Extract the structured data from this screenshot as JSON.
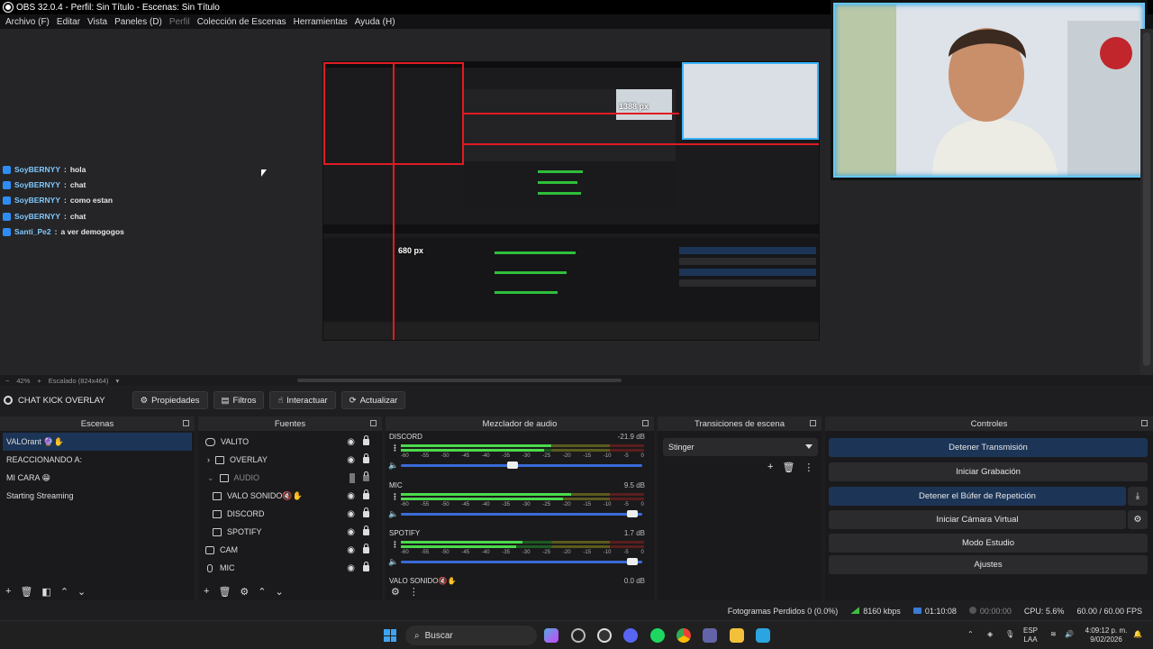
{
  "window": {
    "title": "OBS 32.0.4 - Perfil: Sin Título - Escenas: Sin Título"
  },
  "menu": [
    {
      "label": "Archivo (F)",
      "disabled": false
    },
    {
      "label": "Editar",
      "disabled": false
    },
    {
      "label": "Vista",
      "disabled": false
    },
    {
      "label": "Paneles (D)",
      "disabled": false
    },
    {
      "label": "Perfil",
      "disabled": true
    },
    {
      "label": "Colección de Escenas",
      "disabled": false
    },
    {
      "label": "Herramientas",
      "disabled": false
    },
    {
      "label": "Ayuda (H)",
      "disabled": false
    }
  ],
  "chat": [
    {
      "user": "SoyBERNYY",
      "text": "hola"
    },
    {
      "user": "SoyBERNYY",
      "text": "chat"
    },
    {
      "user": "SoyBERNYY",
      "text": "como estan"
    },
    {
      "user": "SoyBERNYY",
      "text": "chat"
    },
    {
      "user": "Santi_Pe2",
      "text": "a ver demogogos"
    }
  ],
  "preview": {
    "label_width": "1388 px",
    "label_height": "680 px",
    "zoom": "42%",
    "scaling": "Escalado (824x464)"
  },
  "source_toolbar": {
    "source_name": "CHAT KICK OVERLAY",
    "properties": "Propiedades",
    "filters": "Filtros",
    "interact": "Interactuar",
    "refresh": "Actualizar"
  },
  "scenes": {
    "title": "Escenas",
    "items": [
      {
        "label": "VALOrant 🔮✋",
        "active": true
      },
      {
        "label": "REACCIONANDO A:",
        "active": false
      },
      {
        "label": "MI CARA 😁",
        "active": false
      },
      {
        "label": "Starting Streaming",
        "active": false
      }
    ]
  },
  "sources": {
    "title": "Fuentes",
    "items": [
      {
        "label": "VALITO",
        "indent": 0,
        "icon": "gamepad-icon",
        "dim": false
      },
      {
        "label": "OVERLAY",
        "indent": 1,
        "icon": "folder-icon",
        "dim": false
      },
      {
        "label": "AUDIO",
        "indent": 1,
        "icon": "folder-icon",
        "dim": true
      },
      {
        "label": "VALO SONIDO🔇✋",
        "indent": 2,
        "icon": "window-icon",
        "dim": false
      },
      {
        "label": "DISCORD",
        "indent": 2,
        "icon": "window-icon",
        "dim": false
      },
      {
        "label": "SPOTIFY",
        "indent": 2,
        "icon": "window-icon",
        "dim": false
      },
      {
        "label": "CAM",
        "indent": 0,
        "icon": "camera-icon",
        "dim": false
      },
      {
        "label": "MIC",
        "indent": 0,
        "icon": "mic-icon",
        "dim": false
      }
    ]
  },
  "mixer": {
    "title": "Mezclador de audio",
    "ticks": [
      "-60",
      "-55",
      "-50",
      "-45",
      "-40",
      "-35",
      "-30",
      "-25",
      "-20",
      "-15",
      "-10",
      "-5",
      "0"
    ],
    "channels": [
      {
        "name": "DISCORD",
        "db": "-21.9 dB",
        "level": 0.62,
        "fader": 0.46
      },
      {
        "name": "MIC",
        "db": "9.5 dB",
        "level": 0.7,
        "fader": 0.98
      },
      {
        "name": "SPOTIFY",
        "db": "1.7 dB",
        "level": 0.5,
        "fader": 0.98
      },
      {
        "name": "VALO SONIDO🔇✋",
        "db": "0.0 dB",
        "level": 0.0,
        "fader": 1.0
      }
    ]
  },
  "transitions": {
    "title": "Transiciones de escena",
    "selected": "Stinger"
  },
  "controls": {
    "title": "Controles",
    "buttons": [
      {
        "label": "Detener Transmisión",
        "active": true
      },
      {
        "label": "Iniciar Grabación",
        "active": false
      },
      {
        "label": "Detener el Búfer de Repetición",
        "active": true
      },
      {
        "label": "Iniciar Cámara Virtual",
        "active": false
      },
      {
        "label": "Modo Estudio",
        "active": false
      },
      {
        "label": "Ajustes",
        "active": false
      }
    ]
  },
  "status": {
    "dropped": "Fotogramas Perdidos 0 (0.0%)",
    "bitrate": "8160 kbps",
    "stream_time": "01:10:08",
    "rec_time": "00:00:00",
    "cpu": "CPU: 5.6%",
    "fps": "60.00 / 60.00 FPS"
  },
  "taskbar": {
    "search_placeholder": "Buscar",
    "lang_top": "ESP",
    "lang_bottom": "LAA",
    "time": "4:09:12 p. m.",
    "date": "9/02/2026"
  },
  "colors": {
    "accent": "#1c3557",
    "meter_green": "#4cd94c",
    "guide_red": "#e01b24",
    "kick_blue": "#2e8df5"
  }
}
